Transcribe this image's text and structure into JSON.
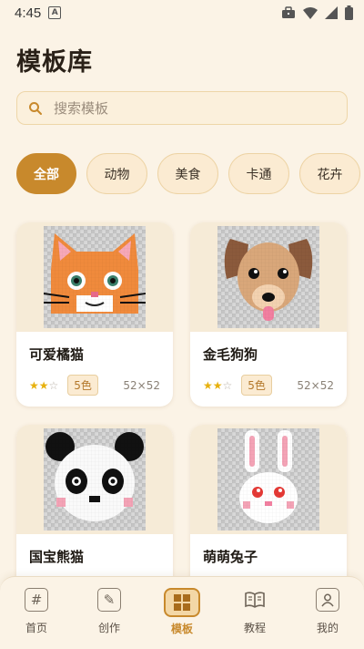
{
  "status_bar": {
    "time": "4:45",
    "sim_label": "A"
  },
  "header": {
    "title": "模板库"
  },
  "search": {
    "placeholder": "搜索模板"
  },
  "categories": [
    {
      "label": "全部",
      "active": true
    },
    {
      "label": "动物",
      "active": false
    },
    {
      "label": "美食",
      "active": false
    },
    {
      "label": "卡通",
      "active": false
    },
    {
      "label": "花卉",
      "active": false
    }
  ],
  "templates": [
    {
      "name": "可爱橘猫",
      "stars": 2,
      "max_stars": 3,
      "colors": "5色",
      "size": "52×52",
      "icon": "orange-cat-pixel-art"
    },
    {
      "name": "金毛狗狗",
      "stars": 2,
      "max_stars": 3,
      "colors": "5色",
      "size": "52×52",
      "icon": "golden-dog-pixel-art"
    },
    {
      "name": "国宝熊猫",
      "icon": "panda-pixel-art"
    },
    {
      "name": "萌萌兔子",
      "icon": "bunny-pixel-art"
    }
  ],
  "star_glyphs": {
    "on": "★",
    "off": "☆"
  },
  "nav": [
    {
      "label": "首页",
      "icon": "hash-icon",
      "glyph": "#",
      "active": false
    },
    {
      "label": "创作",
      "icon": "pencil-icon",
      "glyph": "✎",
      "active": false
    },
    {
      "label": "模板",
      "icon": "grid-icon",
      "glyph": "",
      "active": true
    },
    {
      "label": "教程",
      "icon": "book-icon",
      "glyph": "",
      "active": false
    },
    {
      "label": "我的",
      "icon": "user-icon",
      "glyph": "",
      "active": false
    }
  ],
  "colors": {
    "accent": "#C8892C",
    "background": "#FBF3E6",
    "chip_bg": "#FBEBD2"
  }
}
